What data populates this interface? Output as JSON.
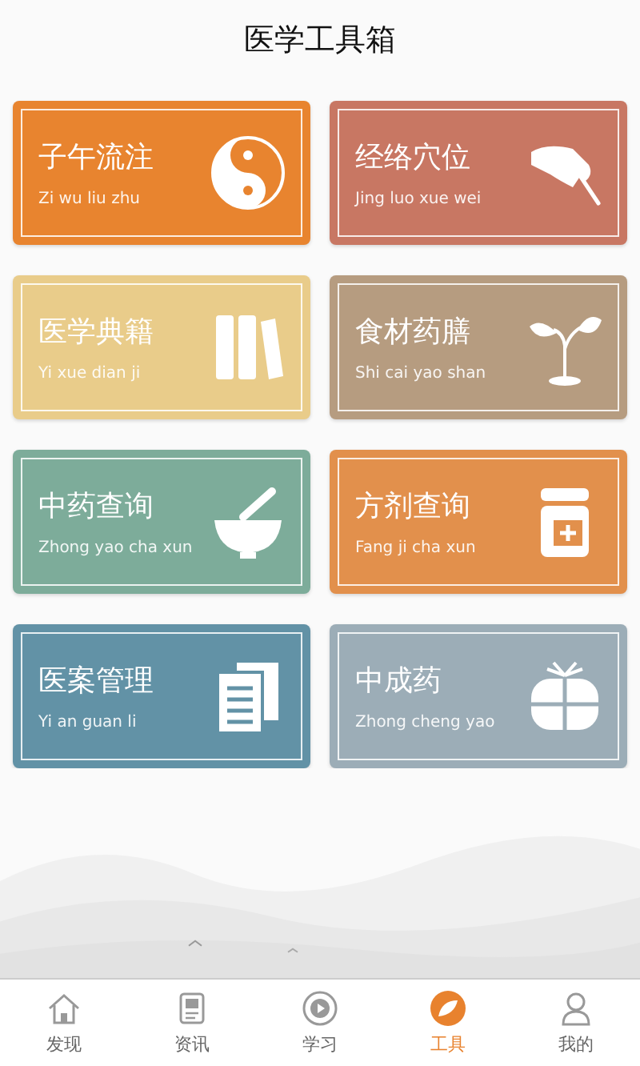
{
  "title": "医学工具箱",
  "cards": [
    {
      "name": "子午流注",
      "pinyin": "Zi wu liu zhu",
      "color": "#e8842f"
    },
    {
      "name": "经络穴位",
      "pinyin": "Jing luo xue wei",
      "color": "#c87763"
    },
    {
      "name": "医学典籍",
      "pinyin": "Yi xue dian ji",
      "color": "#e9cc8a"
    },
    {
      "name": "食材药膳",
      "pinyin": "Shi cai yao shan",
      "color": "#b69c80"
    },
    {
      "name": "中药查询",
      "pinyin": "Zhong yao cha xun",
      "color": "#7dac9a"
    },
    {
      "name": "方剂查询",
      "pinyin": "Fang ji cha xun",
      "color": "#e2904c"
    },
    {
      "name": "医案管理",
      "pinyin": "Yi an guan li",
      "color": "#6292a6"
    },
    {
      "name": "中成药",
      "pinyin": "Zhong cheng yao",
      "color": "#9cadb7"
    }
  ],
  "tabs": [
    {
      "label": "发现",
      "selected": false
    },
    {
      "label": "资讯",
      "selected": false
    },
    {
      "label": "学习",
      "selected": false
    },
    {
      "label": "工具",
      "selected": true
    },
    {
      "label": "我的",
      "selected": false
    }
  ]
}
